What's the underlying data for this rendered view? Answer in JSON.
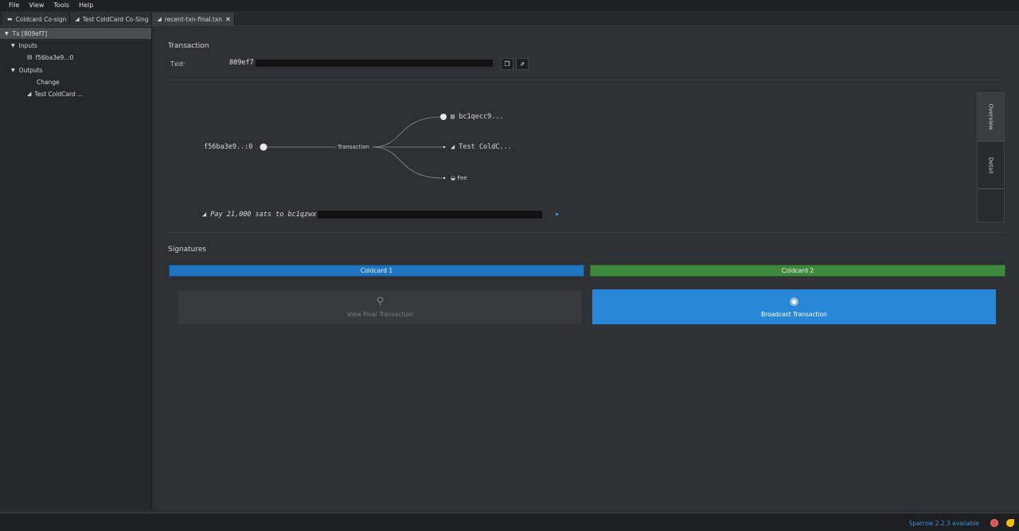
{
  "menu": [
    "File",
    "View",
    "Tools",
    "Help"
  ],
  "tabs": [
    {
      "label": "Coldcard Co-sign",
      "icon": "wallet-icon",
      "active": false
    },
    {
      "label": "Test ColdCard Co-Sing",
      "icon": "send-icon",
      "active": false
    },
    {
      "label": "recent-txn-final.txn",
      "icon": "send-icon",
      "active": true,
      "close": "✕"
    }
  ],
  "tree": {
    "root": "Tx [809ef7]",
    "inputs_label": "Inputs",
    "input_item": "f56ba3e9..:0",
    "outputs_label": "Outputs",
    "change_label": "Change",
    "output_item": "Test ColdCard ..."
  },
  "transaction": {
    "title": "Transaction",
    "txid_label": "Txid:",
    "txid_value": "809ef7"
  },
  "diagram": {
    "input": "f56ba3e9..:0",
    "center": "Transaction",
    "out_change": "bc1qecc9...",
    "out_recipient": "Test ColdC...",
    "fee": "Fee",
    "summary": "Pay 21,000 sats to bc1qzwx"
  },
  "side_tabs": {
    "overview": "Overview",
    "detail": "Detail"
  },
  "signatures": {
    "title": "Signatures",
    "signer1": "Coldcard 1",
    "signer2": "Coldcard 2",
    "view_final": "View Final Transaction",
    "broadcast": "Broadcast Transaction"
  },
  "status": {
    "update_text": "Sparrow 2.2.3 available"
  },
  "colors": {
    "signer1": "#1f75c0",
    "signer2": "#3d8a3d",
    "broadcast": "#2a87d8",
    "link": "#3b8fd6"
  }
}
